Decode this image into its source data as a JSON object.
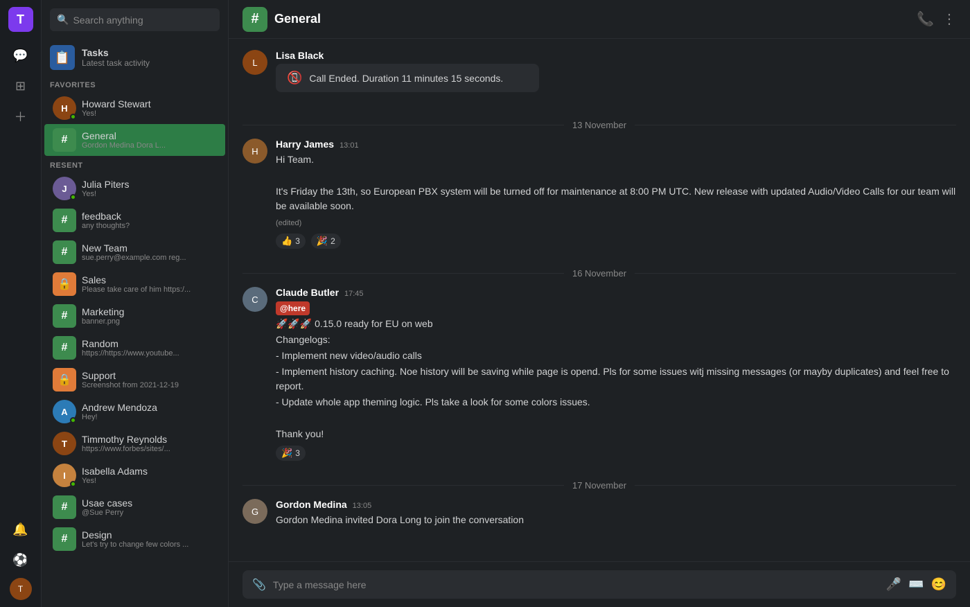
{
  "app": {
    "logo": "T",
    "channel_name": "General"
  },
  "sidebar": {
    "search_placeholder": "Search anything",
    "tasks": {
      "title": "Tasks",
      "subtitle": "Latest task activity"
    },
    "sections": {
      "favorites_label": "FAVORITES",
      "recent_label": "RESENT"
    },
    "favorites": [
      {
        "id": "howard",
        "name": "Howard Stewart",
        "sub": "Yes!",
        "type": "user",
        "online": true,
        "avatar_color": "#8b4513"
      }
    ],
    "channels": [
      {
        "id": "general",
        "name": "General",
        "sub": "Gordon Medina Dora L...",
        "type": "hash",
        "active": true
      }
    ],
    "recent": [
      {
        "id": "julia",
        "name": "Julia Piters",
        "sub": "Yes!",
        "type": "user",
        "online": true,
        "avatar_color": "#6b5b95"
      },
      {
        "id": "feedback",
        "name": "feedback",
        "sub": "any thoughts?",
        "type": "hash"
      },
      {
        "id": "newteam",
        "name": "New Team",
        "sub": "sue.perry@example.com reg...",
        "type": "hash"
      },
      {
        "id": "sales",
        "name": "Sales",
        "sub": "Please take care of him https:/...",
        "type": "lock"
      },
      {
        "id": "marketing",
        "name": "Marketing",
        "sub": "banner.png",
        "type": "hash"
      },
      {
        "id": "random",
        "name": "Random",
        "sub": "https://https://www.youtube...",
        "type": "hash"
      },
      {
        "id": "support",
        "name": "Support",
        "sub": "Screenshot from 2021-12-19",
        "type": "lock"
      },
      {
        "id": "andrew",
        "name": "Andrew Mendoza",
        "sub": "Hey!",
        "type": "user",
        "online": true,
        "avatar_color": "#2c7bb6"
      },
      {
        "id": "timmothy",
        "name": "Timmothy Reynolds",
        "sub": "https://www.forbes/sites/...",
        "type": "user",
        "online": false,
        "avatar_color": "#8b4513"
      },
      {
        "id": "isabella",
        "name": "Isabella Adams",
        "sub": "Yes!",
        "type": "user",
        "online": true,
        "avatar_color": "#c5823e"
      },
      {
        "id": "usecases",
        "name": "Usae cases",
        "sub": "@Sue Perry",
        "type": "hash"
      },
      {
        "id": "design",
        "name": "Design",
        "sub": "Let's try to change few colors ...",
        "type": "hash"
      }
    ]
  },
  "chat": {
    "call_ended": {
      "text": "Call Ended. Duration 11 minutes 15 seconds."
    },
    "date_dividers": {
      "date1": "13 November",
      "date2": "16  November",
      "date3": "17  November"
    },
    "messages": [
      {
        "id": "msg1",
        "user": "Harry James",
        "time": "13:01",
        "avatar_color": "#8b5a2b",
        "lines": [
          "Hi Team.",
          "",
          "It's Friday the 13th, so European PBX system will be turned off for maintenance at 8:00 PM UTC. New release with updated Audio/Video Calls for our team will be available soon.",
          "(edited)"
        ],
        "reactions": [
          {
            "emoji": "👍",
            "count": "3"
          },
          {
            "emoji": "🎉",
            "count": "2"
          }
        ]
      },
      {
        "id": "msg2",
        "user": "Claude Butler",
        "time": "17:45",
        "avatar_color": "#5a6b7b",
        "at_here": true,
        "lines": [
          "🚀🚀🚀 0.15.0 ready for EU on web",
          "Changelogs:",
          "- Implement new video/audio calls",
          "- Implement history caching. Noe history will be saving while page is opend. Pls for some issues witj missing messages (or mayby duplicates) and  feel free to report.",
          "- Update whole app theming logic. Pls take a look for some colors issues.",
          "",
          "Thank you!"
        ],
        "reactions": [
          {
            "emoji": "🎉",
            "count": "3"
          }
        ]
      },
      {
        "id": "msg3",
        "user": "Gordon Medina",
        "time": "13:05",
        "avatar_color": "#7b6b5b",
        "lines": [
          "Gordon Medina invited Dora Long to join the conversation"
        ]
      }
    ],
    "input_placeholder": "Type a message here",
    "lisa_user": "Lisa Black"
  },
  "icons": {
    "search": "🔍",
    "hash": "#",
    "lock": "🔒",
    "phone": "📞",
    "more": "⋮",
    "attach": "📎",
    "mic": "🎤",
    "keyboard": "⌨",
    "emoji": "😊",
    "chat": "💬",
    "grid": "⊞",
    "plus": "+",
    "bell": "🔔",
    "soccer": "⚽"
  }
}
